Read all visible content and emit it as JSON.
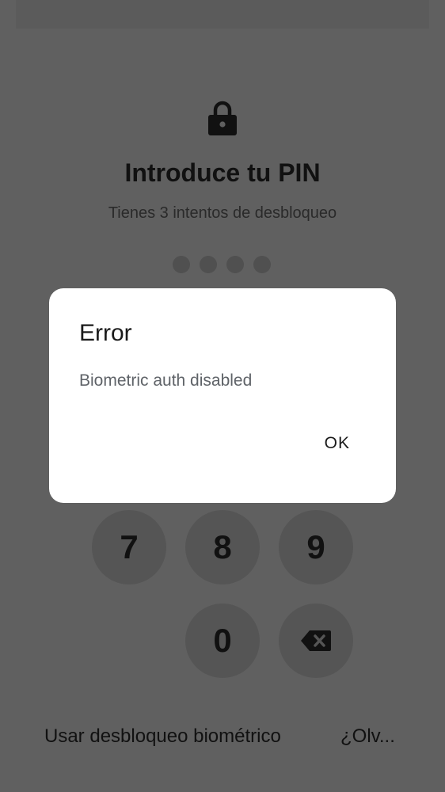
{
  "pin_screen": {
    "lock_icon": "lock-icon",
    "title": "Introduce tu PIN",
    "subtitle": "Tienes 3 intentos de desbloqueo",
    "pin_length": 4,
    "keys": {
      "k7": "7",
      "k8": "8",
      "k9": "9",
      "k0": "0",
      "delete_icon": "backspace-icon"
    },
    "biometric_link": "Usar desbloqueo biométrico",
    "forgot_link": "¿Olv..."
  },
  "dialog": {
    "title": "Error",
    "message": "Biometric auth disabled",
    "ok_label": "OK"
  },
  "colors": {
    "scrim": "#606060",
    "dialog_background": "#ffffff",
    "text": "#111111",
    "message_text": "#5f6368"
  }
}
